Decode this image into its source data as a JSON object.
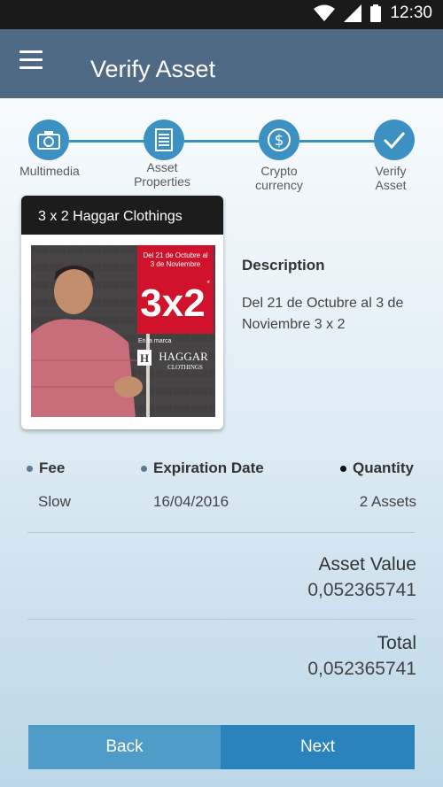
{
  "status_bar": {
    "time": "12:30",
    "icons": [
      "wifi-icon",
      "signal-icon",
      "battery-icon"
    ]
  },
  "app_bar": {
    "title": "Verify Asset",
    "menu_icon": "hamburger-icon"
  },
  "stepper": {
    "color": "#3d90c2",
    "steps": [
      {
        "label": "Multimedia",
        "icon": "camera-icon"
      },
      {
        "label": "Asset\nProperties",
        "icon": "document-icon"
      },
      {
        "label": "Crypto\ncurrency",
        "icon": "dollar-coin-icon"
      },
      {
        "label": "Verify\nAsset",
        "icon": "checkmark-icon"
      }
    ]
  },
  "asset_card": {
    "title": "3 x 2 Haggar Clothings",
    "promo": {
      "dates_line1": "Del 21 de Octubre al",
      "dates_line2": "3 de Noviembre",
      "headline": "3x2",
      "headline_mark": "*",
      "brand_intro": "En la marca",
      "brand_name": "HAGGAR",
      "brand_sub": "CLOTHINGS",
      "brand_logo_letter": "H"
    }
  },
  "description": {
    "label": "Description",
    "text": "Del 21 de Octubre al 3 de Noviembre 3 x 2"
  },
  "details": {
    "fee": {
      "label": "Fee",
      "value": "Slow",
      "bullet_color": "#5b7a93"
    },
    "expiration": {
      "label": "Expiration Date",
      "value": "16/04/2016",
      "bullet_color": "#5b7a93"
    },
    "quantity": {
      "label": "Quantity",
      "value": "2 Assets",
      "bullet_color": "#111111"
    }
  },
  "asset_value": {
    "label": "Asset Value",
    "value": "0,052365741"
  },
  "total": {
    "label": "Total",
    "value": "0,052365741"
  },
  "buttons": {
    "back": "Back",
    "next": "Next"
  },
  "colors": {
    "app_bar": "#4f6a85",
    "accent": "#3d90c2",
    "back_button": "#4e9cc7",
    "next_button": "#2a83bc",
    "promo_red": "#d0122c"
  }
}
